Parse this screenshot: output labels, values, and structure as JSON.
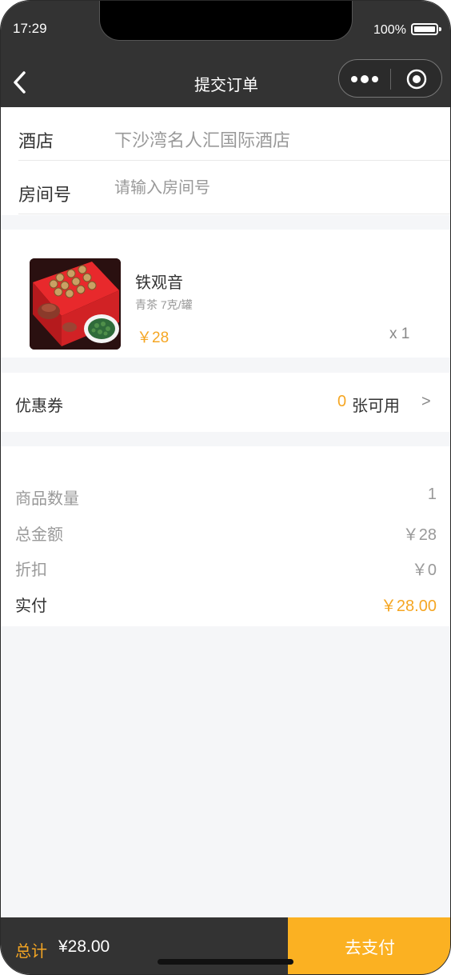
{
  "status_bar": {
    "time": "17:29",
    "battery": "100%"
  },
  "nav": {
    "title": "提交订单",
    "back_icon": "chevron-left-icon",
    "more_icon": "more-dots-icon",
    "close_icon": "target-icon"
  },
  "form": {
    "hotel_label": "酒店",
    "hotel_value": "下沙湾名人汇国际酒店",
    "room_label": "房间号",
    "room_placeholder": "请输入房间号",
    "room_value": ""
  },
  "product": {
    "name": "铁观音",
    "spec": "青茶 7克/罐",
    "price": "￥28",
    "quantity": "x 1",
    "image_icon": "tea-gift-box-image"
  },
  "coupon": {
    "label": "优惠券",
    "count": "0",
    "unit": "张可用",
    "arrow": ">"
  },
  "summary": [
    {
      "label": "商品数量",
      "value": "1"
    },
    {
      "label": "总金额",
      "value": "￥28"
    },
    {
      "label": "折扣",
      "value": "￥0"
    },
    {
      "label": "实付",
      "value": "￥28.00"
    }
  ],
  "footer": {
    "total_label": "总计",
    "total_value": "¥28.00",
    "pay_button": "去支付"
  },
  "colors": {
    "nav_bg": "#333333",
    "accent": "#f5a623",
    "pay_button": "#fbb122",
    "page_bg": "#f5f6f8"
  }
}
